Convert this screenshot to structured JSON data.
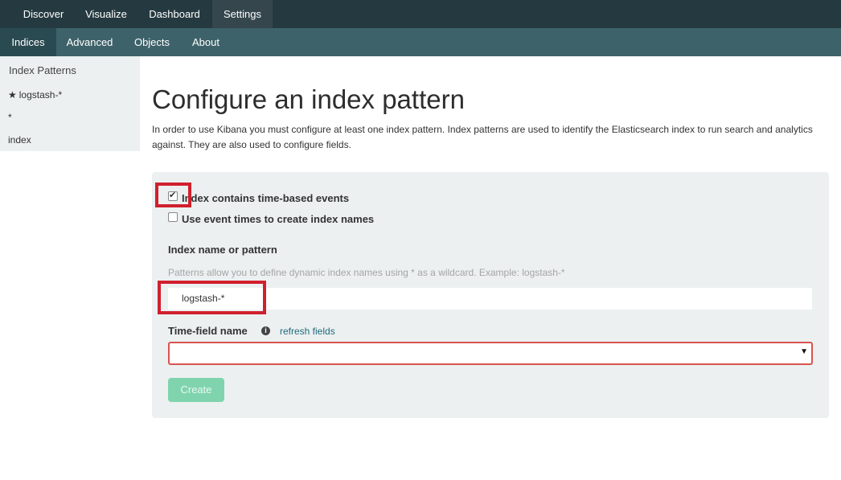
{
  "topnav": {
    "items": [
      {
        "label": "Discover"
      },
      {
        "label": "Visualize"
      },
      {
        "label": "Dashboard"
      },
      {
        "label": "Settings",
        "active": true
      }
    ]
  },
  "subnav": {
    "items": [
      {
        "label": "Indices",
        "active": true
      },
      {
        "label": "Advanced"
      },
      {
        "label": "Objects"
      },
      {
        "label": "About"
      }
    ]
  },
  "sidebar": {
    "title": "Index Patterns",
    "items": [
      {
        "label": "logstash-*",
        "default": true,
        "icon": "star-icon"
      },
      {
        "label": "*"
      },
      {
        "label": "index"
      }
    ]
  },
  "main": {
    "title": "Configure an index pattern",
    "description": "In order to use Kibana you must configure at least one index pattern. Index patterns are used to identify the Elasticsearch index to run search and analytics against. They are also used to configure fields.",
    "form": {
      "time_based": {
        "label": "Index contains time-based events",
        "checked": true
      },
      "event_times": {
        "label": "Use event times to create index names",
        "checked": false
      },
      "index_name_label": "Index name or pattern",
      "index_name_hint": "Patterns allow you to define dynamic index names using * as a wildcard. Example: logstash-*",
      "index_name_value": "logstash-*",
      "time_field_label": "Time-field name",
      "refresh_link": "refresh fields",
      "time_field_value": "",
      "create_label": "Create"
    }
  },
  "colors": {
    "topnav_bg": "#253a40",
    "subnav_bg": "#3e6269",
    "highlight": "#d0202e",
    "create_button": "#7fd4ad",
    "select_border_error": "#d9534f"
  }
}
